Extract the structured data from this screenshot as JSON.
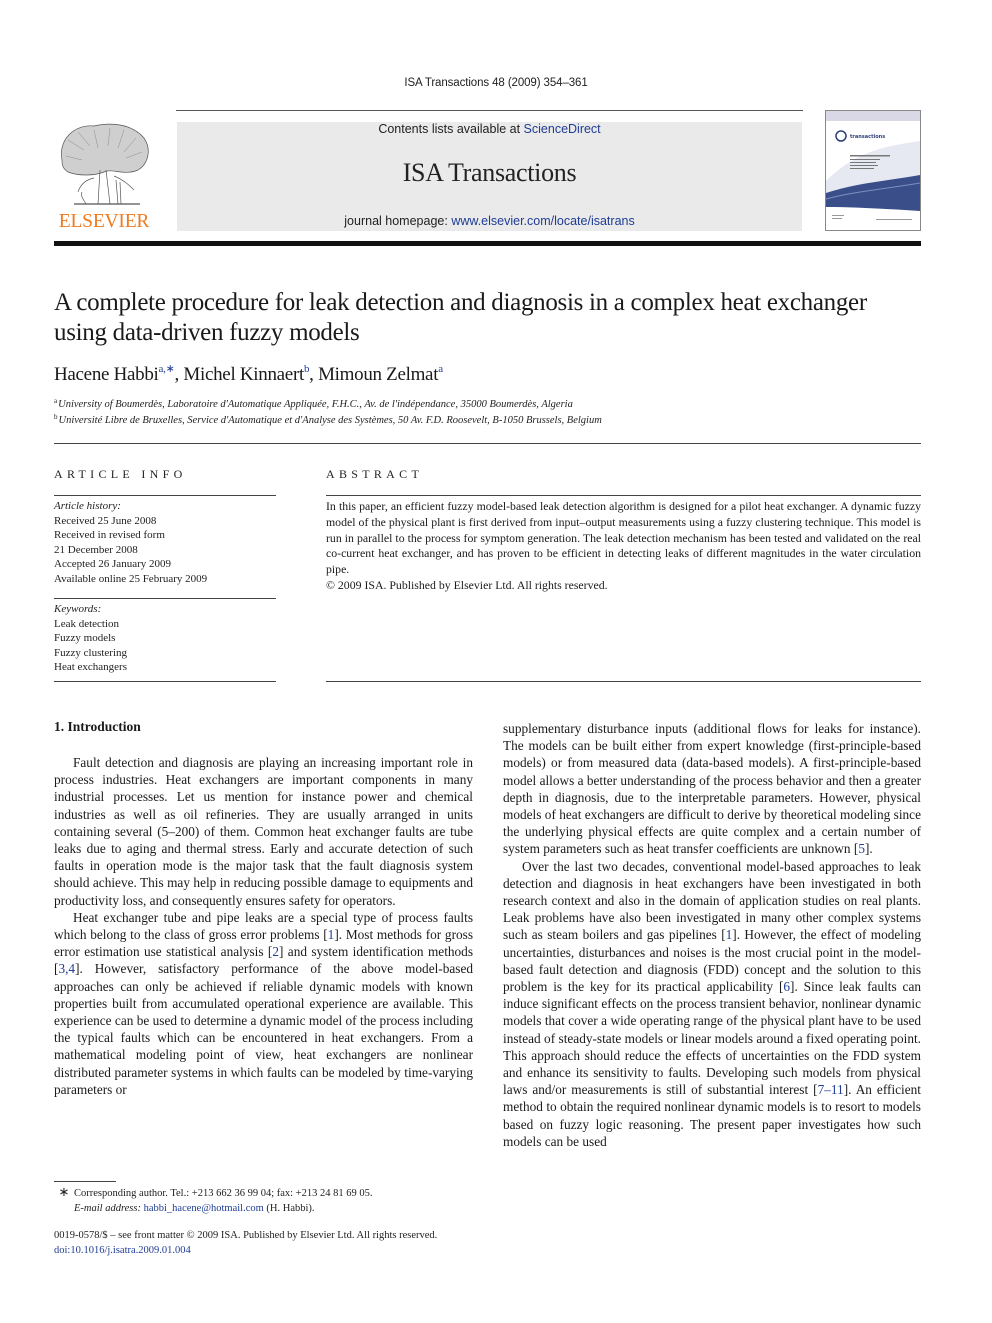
{
  "running_head": "ISA Transactions 48 (2009) 354–361",
  "masthead": {
    "contents_prefix": "Contents lists available at ",
    "contents_link": "ScienceDirect",
    "journal_title": "ISA Transactions",
    "homepage_prefix": "journal homepage: ",
    "homepage_link": "www.elsevier.com/locate/isatrans"
  },
  "publisher_logo_text": "ELSEVIER",
  "cover": {
    "journal_name": "transactions",
    "badge": "ISA"
  },
  "colors": {
    "link": "#1f3c94",
    "elsevier_orange": "#f07a1e",
    "masthead_bg": "#eaeaea"
  },
  "article": {
    "title": "A complete procedure for leak detection and diagnosis in a complex heat exchanger using data-driven fuzzy models",
    "authors": [
      {
        "name": "Hacene Habbi",
        "sup": "a,∗"
      },
      {
        "name": "Michel Kinnaert",
        "sup": "b"
      },
      {
        "name": "Mimoun Zelmat",
        "sup": "a"
      }
    ],
    "affiliations": [
      {
        "label": "a",
        "text": "University of Boumerdès, Laboratoire d'Automatique Appliquée, F.H.C., Av. de l'indépendance, 35000 Boumerdès, Algeria"
      },
      {
        "label": "b",
        "text": "Université Libre de Bruxelles, Service d'Automatique et d'Analyse des Systèmes, 50 Av. F.D. Roosevelt, B-1050 Brussels, Belgium"
      }
    ]
  },
  "article_info": {
    "heading": "ARTICLE INFO",
    "history_label": "Article history:",
    "history": [
      "Received 25 June 2008",
      "Received in revised form",
      "21 December 2008",
      "Accepted 26 January 2009",
      "Available online 25 February 2009"
    ],
    "keywords_label": "Keywords:",
    "keywords": [
      "Leak detection",
      "Fuzzy models",
      "Fuzzy clustering",
      "Heat exchangers"
    ]
  },
  "abstract": {
    "heading": "ABSTRACT",
    "text": "In this paper, an efficient fuzzy model-based leak detection algorithm is designed for a pilot heat exchanger. A dynamic fuzzy model of the physical plant is first derived from input–output measurements using a fuzzy clustering technique. This model is run in parallel to the process for symptom generation. The leak detection mechanism has been tested and validated on the real co-current heat exchanger, and has proven to be efficient in detecting leaks of different magnitudes in the water circulation pipe.",
    "copyright": "© 2009 ISA. Published by Elsevier Ltd. All rights reserved."
  },
  "body": {
    "section_heading": "1.  Introduction",
    "left_paragraphs": [
      {
        "segments": [
          {
            "t": "Fault detection and diagnosis are playing an increasing important role in process industries. Heat exchangers are important components in many industrial processes. Let us mention for instance power and chemical industries as well as oil refineries. They are usually arranged in units containing several (5–200) of them. Common heat exchanger faults are tube leaks due to aging and thermal stress. Early and accurate detection of such faults in operation mode is the major task that the fault diagnosis system should achieve. This may help in reducing possible damage to equipments and productivity loss, and consequently ensures safety for operators."
          }
        ]
      },
      {
        "segments": [
          {
            "t": "Heat exchanger tube and pipe leaks are a special type of process faults which belong to the class of gross error problems ["
          },
          {
            "t": "1",
            "ref": true
          },
          {
            "t": "]. Most methods for gross error estimation use statistical analysis ["
          },
          {
            "t": "2",
            "ref": true
          },
          {
            "t": "] and system identification methods ["
          },
          {
            "t": "3,4",
            "ref": true
          },
          {
            "t": "]. However, satisfactory performance of the above model-based approaches can only be achieved if reliable dynamic models with known properties built from accumulated operational experience are available. This experience can be used to determine a dynamic model of the process including the typical faults which can be encountered in heat exchangers. From a mathematical modeling point of view, heat exchangers are nonlinear distributed parameter systems in which faults can be modeled by time-varying parameters or"
          }
        ]
      }
    ],
    "right_paragraphs": [
      {
        "noindent": true,
        "segments": [
          {
            "t": "supplementary disturbance inputs (additional flows for leaks for instance). The models can be built either from expert knowledge (first-principle-based models) or from measured data (data-based models). A first-principle-based model allows a better understanding of the process behavior and then a greater depth in diagnosis, due to the interpretable parameters. However, physical models of heat exchangers are difficult to derive by theoretical modeling since the underlying physical effects are quite complex and a certain number of system parameters such as heat transfer coefficients are unknown ["
          },
          {
            "t": "5",
            "ref": true
          },
          {
            "t": "]."
          }
        ]
      },
      {
        "segments": [
          {
            "t": "Over the last two decades, conventional model-based approaches to leak detection and diagnosis in heat exchangers have been investigated in both research context and also in the domain of application studies on real plants. Leak problems have also been investigated in many other complex systems such as steam boilers and gas pipelines ["
          },
          {
            "t": "1",
            "ref": true
          },
          {
            "t": "]. However, the effect of modeling uncertainties, disturbances and noises is the most crucial point in the model-based fault detection and diagnosis (FDD) concept and the solution to this problem is the key for its practical applicability ["
          },
          {
            "t": "6",
            "ref": true
          },
          {
            "t": "]. Since leak faults can induce significant effects on the process transient behavior, nonlinear dynamic models that cover a wide operating range of the physical plant have to be used instead of steady-state models or linear models around a fixed operating point. This approach should reduce the effects of uncertainties on the FDD system and enhance its sensitivity to faults. Developing such models from physical laws and/or measurements is still of substantial interest ["
          },
          {
            "t": "7–11",
            "ref": true
          },
          {
            "t": "]. An efficient method to obtain the required nonlinear dynamic models is to resort to models based on fuzzy logic reasoning. The present paper investigates how such models can be used"
          }
        ]
      }
    ]
  },
  "footnote": {
    "symbol": "∗",
    "line1": "Corresponding author. Tel.: +213 662 36 99 04; fax: +213 24 81 69 05.",
    "email_label": "E-mail address:",
    "email": "habbi_hacene@hotmail.com",
    "email_suffix": " (H. Habbi)."
  },
  "bottom": {
    "issn_line": "0019-0578/$ – see front matter © 2009 ISA. Published by Elsevier Ltd. All rights reserved.",
    "doi": "doi:10.1016/j.isatra.2009.01.004"
  }
}
